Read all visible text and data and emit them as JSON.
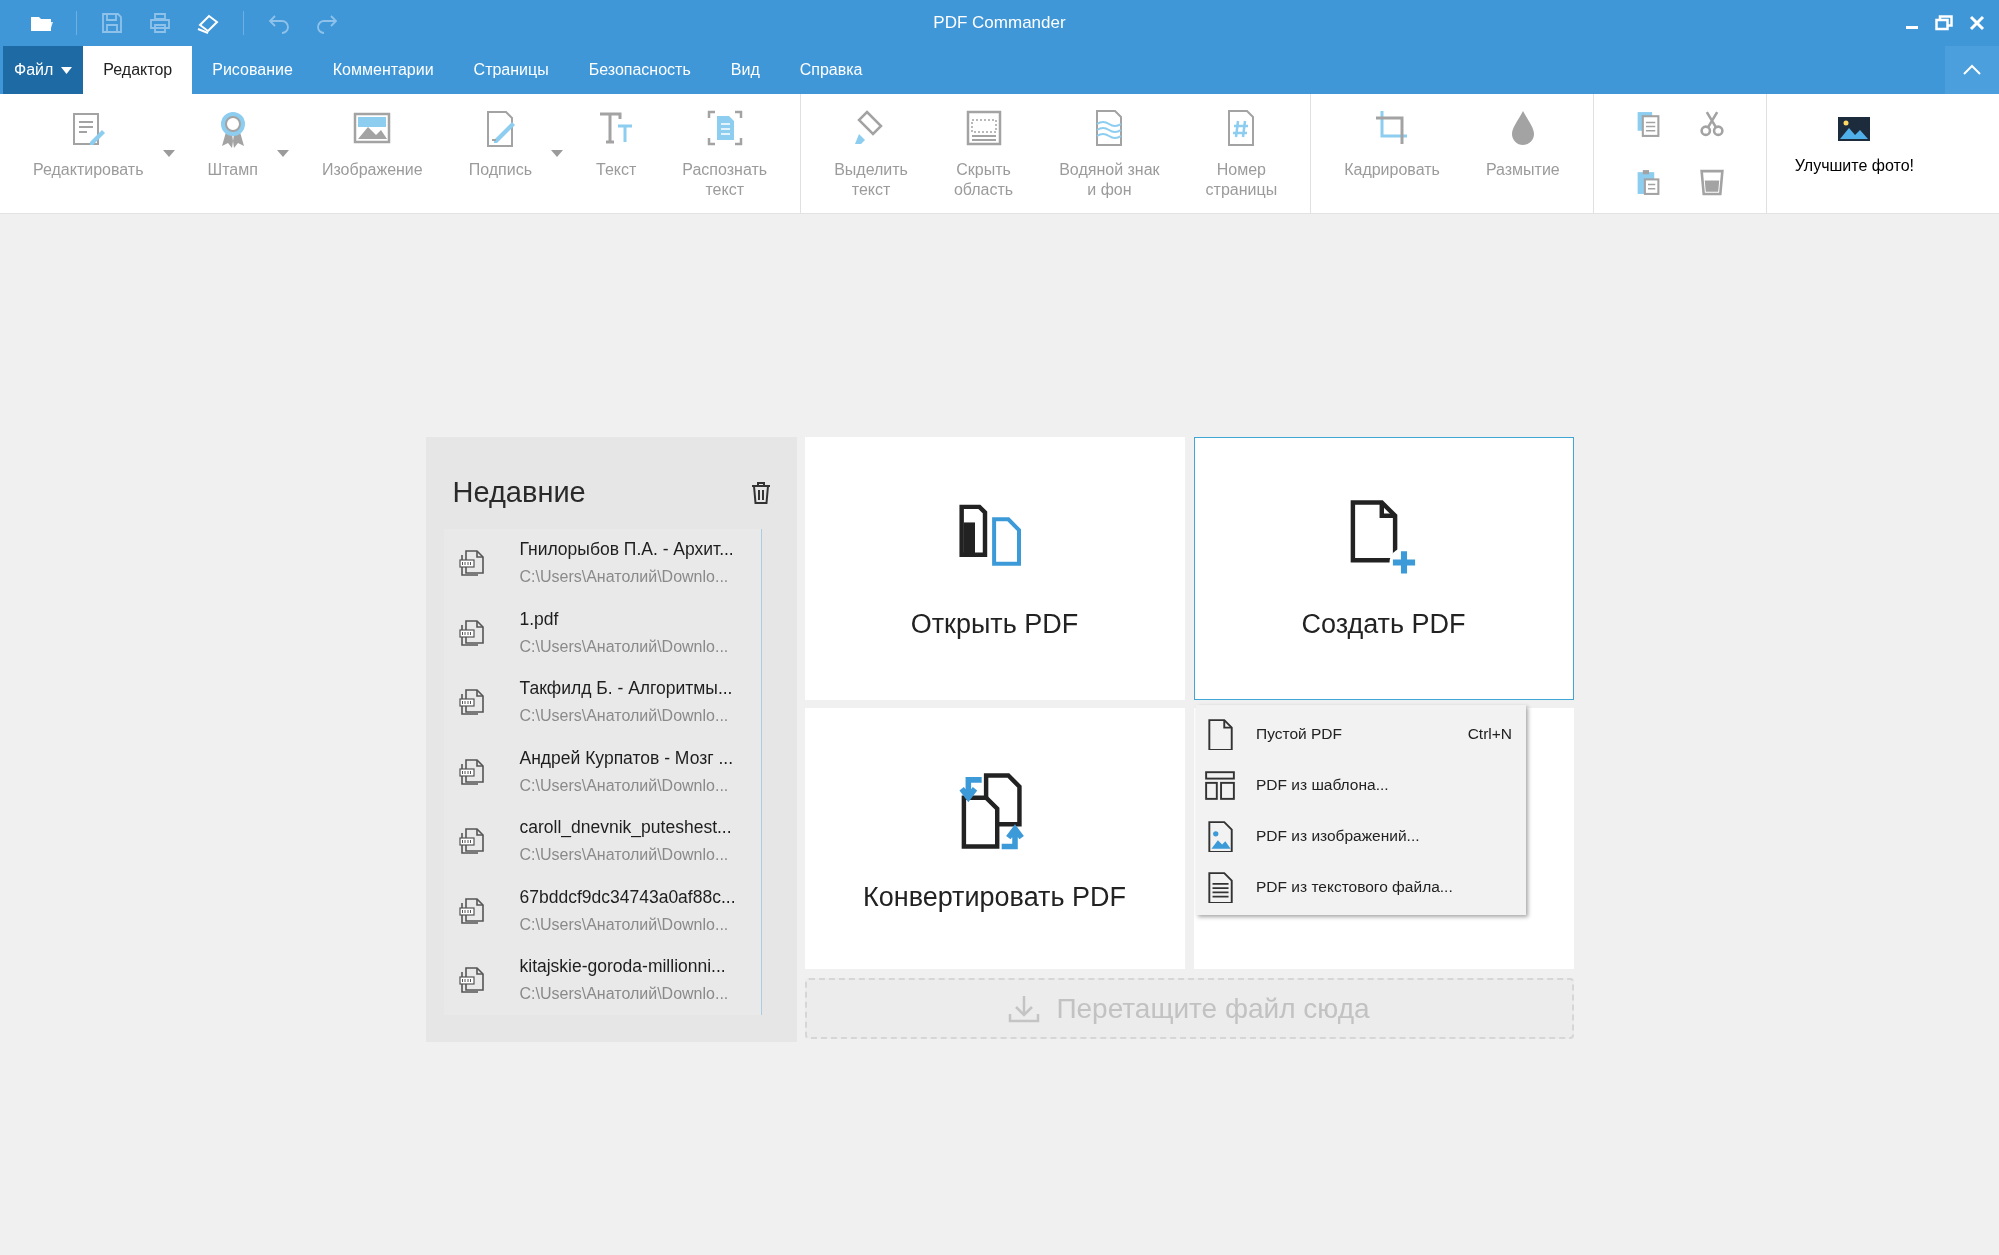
{
  "window": {
    "title": "PDF Commander"
  },
  "quick_access": [
    {
      "disabled": false
    },
    {
      "disabled": true
    },
    {
      "disabled": true
    },
    {
      "disabled": false
    },
    {
      "disabled": true
    },
    {
      "disabled": true
    }
  ],
  "tabs": [
    {
      "label": "Файл",
      "kind": "file",
      "selected": false
    },
    {
      "label": "Редактор",
      "kind": "tab",
      "selected": true
    },
    {
      "label": "Рисование",
      "kind": "tab",
      "selected": false
    },
    {
      "label": "Комментарии",
      "kind": "tab",
      "selected": false
    },
    {
      "label": "Страницы",
      "kind": "tab",
      "selected": false
    },
    {
      "label": "Безопасность",
      "kind": "tab",
      "selected": false
    },
    {
      "label": "Вид",
      "kind": "tab",
      "selected": false
    },
    {
      "label": "Справка",
      "kind": "tab",
      "selected": false
    }
  ],
  "toolbar": {
    "groups": [
      {
        "items": [
          {
            "label": "Редактировать",
            "disabled": true,
            "dropdown": true
          },
          {
            "label": "Штамп",
            "disabled": true,
            "dropdown": true
          },
          {
            "label": "Изображение",
            "disabled": true,
            "dropdown": false
          },
          {
            "label": "Подпись",
            "disabled": true,
            "dropdown": true
          },
          {
            "label": "Текст",
            "disabled": true,
            "dropdown": false
          },
          {
            "label": "Распознать\nтекст",
            "disabled": true,
            "dropdown": false
          }
        ]
      },
      {
        "items": [
          {
            "label": "Выделить\nтекст",
            "disabled": true,
            "dropdown": false
          },
          {
            "label": "Скрыть\nобласть",
            "disabled": true,
            "dropdown": false
          },
          {
            "label": "Водяной знак\nи фон",
            "disabled": true,
            "dropdown": false
          },
          {
            "label": "Номер\nстраницы",
            "disabled": true,
            "dropdown": false
          }
        ]
      },
      {
        "items": [
          {
            "label": "Кадрировать",
            "disabled": true,
            "dropdown": false
          },
          {
            "label": "Размытие",
            "disabled": true,
            "dropdown": false
          }
        ]
      }
    ],
    "clipboard": [
      {
        "disabled": true
      },
      {
        "disabled": true
      },
      {
        "disabled": true
      },
      {
        "disabled": true
      }
    ],
    "promo": {
      "label": "Улучшите фото!"
    }
  },
  "recent": {
    "title": "Недавние",
    "items": [
      {
        "name": "Гнилорыбов П.А. - Архит...",
        "path": "C:\\Users\\Анатолий\\Downlo..."
      },
      {
        "name": "1.pdf",
        "path": "C:\\Users\\Анатолий\\Downlo..."
      },
      {
        "name": "Такфилд Б. - Алгоритмы...",
        "path": "C:\\Users\\Анатолий\\Downlo..."
      },
      {
        "name": "Андрей Курпатов - Мозг ...",
        "path": "C:\\Users\\Анатолий\\Downlo..."
      },
      {
        "name": "caroll_dnevnik_puteshest...",
        "path": "C:\\Users\\Анатолий\\Downlo..."
      },
      {
        "name": "67bddcf9dc34743a0af88c...",
        "path": "C:\\Users\\Анатолий\\Downlo..."
      },
      {
        "name": "kitajskie-goroda-millionni...",
        "path": "C:\\Users\\Анатолий\\Downlo..."
      }
    ]
  },
  "actions": [
    {
      "label": "Открыть PDF",
      "selected": false
    },
    {
      "label": "Создать PDF",
      "selected": true
    },
    {
      "label": "Конвертировать PDF",
      "selected": false
    }
  ],
  "create_menu": [
    {
      "label": "Пустой PDF",
      "shortcut": "Ctrl+N"
    },
    {
      "label": "PDF из шаблона..."
    },
    {
      "label": "PDF из изображений..."
    },
    {
      "label": "PDF из текстового файла..."
    }
  ],
  "drop_zone": {
    "label": "Перетащите файл сюда"
  }
}
